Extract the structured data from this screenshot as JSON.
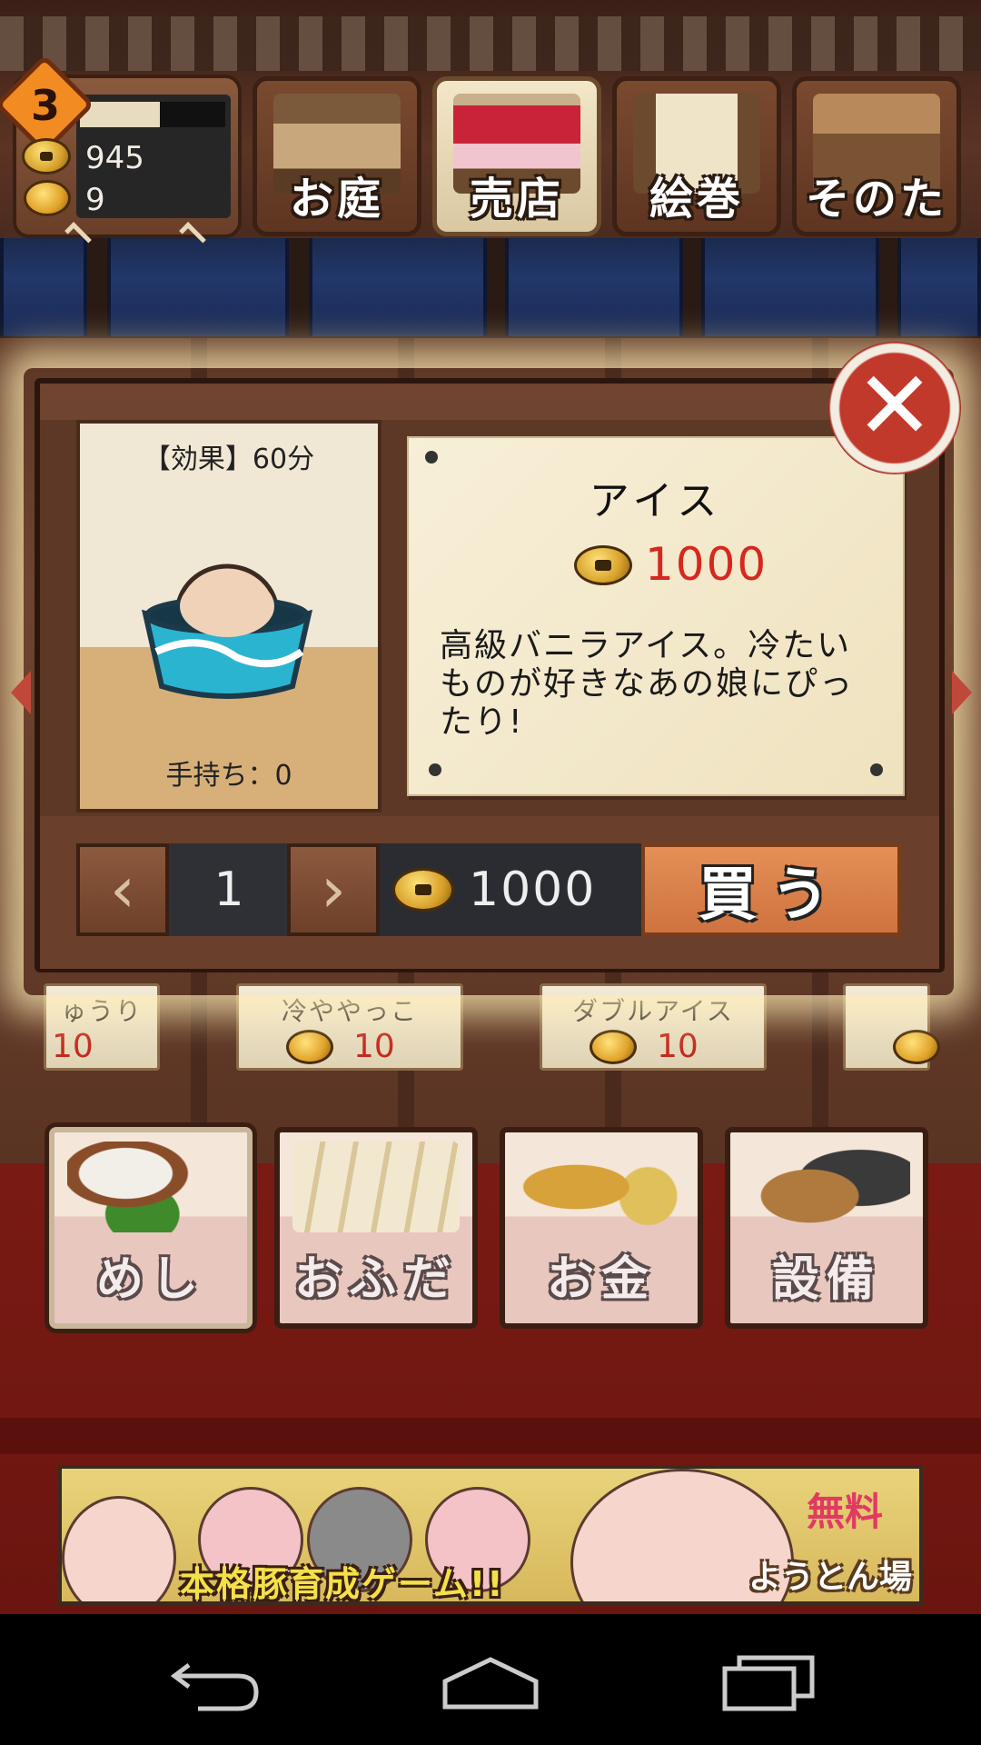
{
  "status": {
    "level": "3",
    "xp_fraction": 0.55,
    "coins": "945",
    "gold": "9"
  },
  "top_tabs": [
    {
      "label": "お庭",
      "icon": "house-icon"
    },
    {
      "label": "売店",
      "icon": "shop-icon",
      "active": true
    },
    {
      "label": "絵巻",
      "icon": "scroll-icon"
    },
    {
      "label": "そのた",
      "icon": "hammer-chest-icon"
    }
  ],
  "item": {
    "effect": "【効果】60分",
    "owned": "手持ち：0",
    "name": "アイス",
    "price": "1000",
    "description": "高級バニラアイス。冷たいものが好きなあの娘にぴったり!"
  },
  "purchase": {
    "prev": "‹",
    "next": "›",
    "quantity": "1",
    "total": "1000",
    "buy_label": "買う"
  },
  "shelf_items": [
    {
      "name": "ゅうり",
      "price": "10"
    },
    {
      "name": "冷ややっこ",
      "price": "10"
    },
    {
      "name": "ダブルアイス",
      "price": "10"
    }
  ],
  "categories": [
    {
      "label": "めし",
      "icon": "food-icon",
      "active": true
    },
    {
      "label": "おふだ",
      "icon": "talisman-icon"
    },
    {
      "label": "お金",
      "icon": "money-icon"
    },
    {
      "label": "設備",
      "icon": "equipment-icon"
    }
  ],
  "banner": {
    "tagline": "本格豚育成ゲーム!!",
    "free": "無料",
    "title": "ようとん場"
  },
  "colors": {
    "accent_red": "#d6281f",
    "buy_orange": "#e58f56",
    "noren_blue": "#22376a"
  }
}
